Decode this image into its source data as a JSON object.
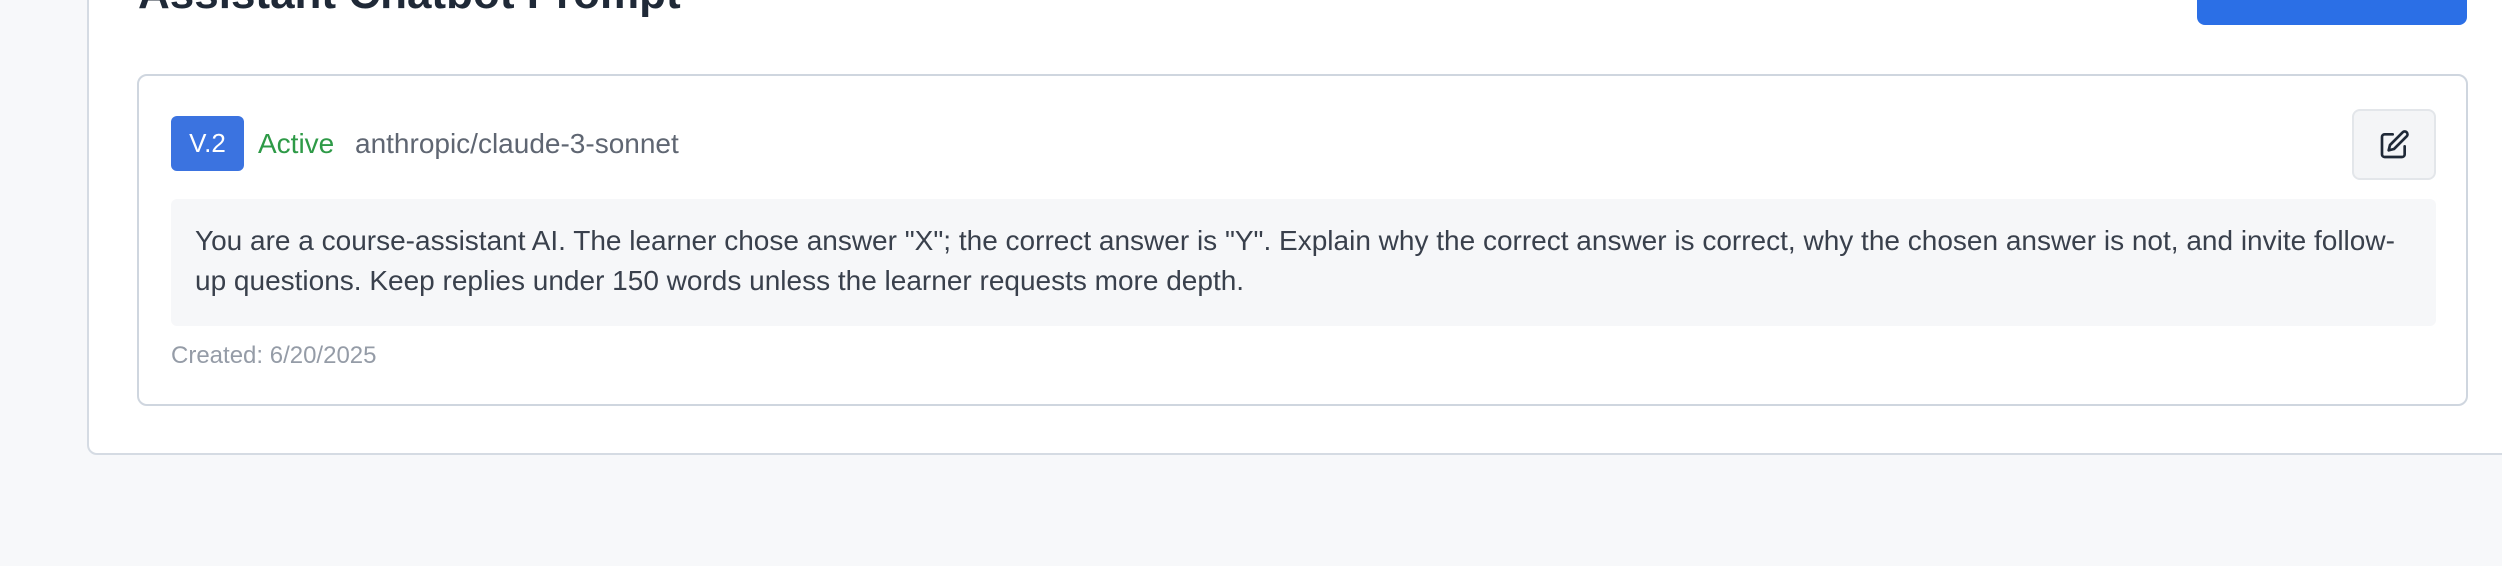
{
  "header": {
    "title": "Assistant Chatbot Prompt"
  },
  "prompt_card": {
    "version": "V.2",
    "status": "Active",
    "model": "anthropic/claude-3-sonnet",
    "prompt_text": "You are a course-assistant AI. The learner chose answer \"X\"; the correct answer is \"Y\". Explain why the correct answer is correct, why the chosen answer is not, and invite follow-up questions. Keep replies under 150 words unless the learner requests more depth.",
    "created": "Created: 6/20/2025",
    "edit_icon": "edit-icon"
  },
  "colors": {
    "primary": "#2b6fe6",
    "badge": "#3b73e0",
    "active_status": "#2e9a47"
  }
}
